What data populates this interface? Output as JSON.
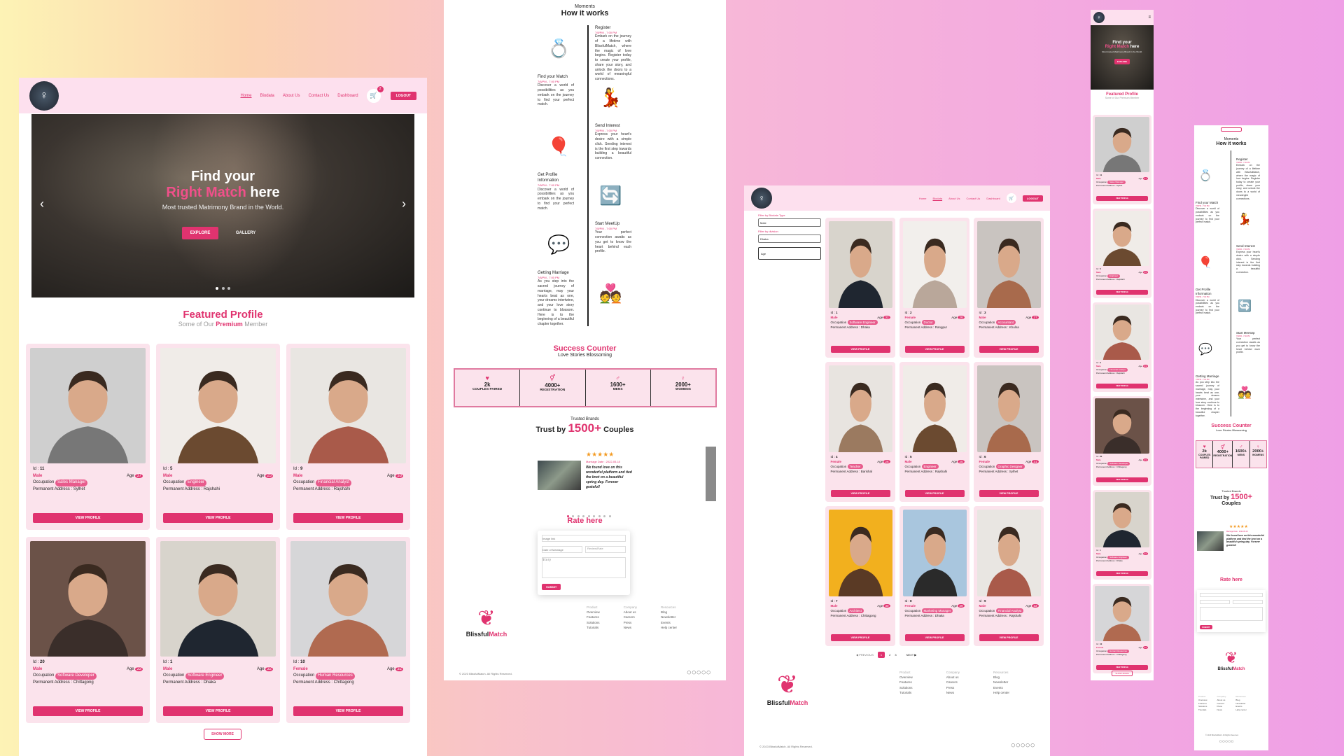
{
  "brand": {
    "name_a": "Blissful",
    "name_b": "Match",
    "copyright": "© 2023 BlissfulMatch. All Rights Reserved."
  },
  "nav": {
    "home": "Home",
    "biodata": "Biodata",
    "about": "About Us",
    "contact": "Contact Us",
    "dashboard": "Dashboard",
    "cart_count": "2",
    "logout": "LOGOUT"
  },
  "hero": {
    "line1": "Find your",
    "line2_accent": "Right Match",
    "line2_rest": " here",
    "subtitle": "Most trusted Matrimony Brand in the World.",
    "explore": "EXPLORE",
    "gallery": "GALLERY",
    "prev": "‹",
    "next": "›"
  },
  "featured": {
    "title": "Featured Profile",
    "sub_a": "Some of Our ",
    "sub_accent": "Premium",
    "sub_b": " Member",
    "show_more": "SHOW MORE",
    "view": "VIEW PROFILE",
    "addr_label": "Permanent Address : ",
    "occ_label": "Occupation ",
    "id_label": "Id : ",
    "age_label": "Age "
  },
  "profiles": [
    {
      "id": "11",
      "gender": "Male",
      "age": "37",
      "occupation": "Sales Manager",
      "address": "Sylhet",
      "tone": "#cfcfcf",
      "tone2": "#777"
    },
    {
      "id": "5",
      "gender": "Male",
      "age": "25",
      "occupation": "Engineer",
      "address": "Rajshahi",
      "tone": "#f0ece8",
      "tone2": "#6b4a30"
    },
    {
      "id": "9",
      "gender": "Male",
      "age": "33",
      "occupation": "Financial Analyst",
      "address": "Rajshahi",
      "tone": "#e9e6e2",
      "tone2": "#a95a4a"
    },
    {
      "id": "20",
      "gender": "Male",
      "age": "33",
      "occupation": "Software Developer",
      "address": "Chittagong",
      "tone": "#6b5248",
      "tone2": "#3a2e2a"
    },
    {
      "id": "1",
      "gender": "Male",
      "age": "32",
      "occupation": "Software Engineer",
      "address": "Dhaka",
      "tone": "#d8d4cc",
      "tone2": "#1f2630"
    },
    {
      "id": "10",
      "gender": "Female",
      "age": "32",
      "occupation": "Human Resources",
      "address": "Chittagong",
      "tone": "#d6d6d8",
      "tone2": "#b06a50"
    }
  ],
  "how": {
    "kicker": "Moments",
    "title": "How it works",
    "steps": [
      {
        "title": "Register",
        "time": "7/8/PM - 7:00 PM",
        "text": "Embark on the journey of a lifetime with BlissfulMatch, where the magic of love begins. Register today to create your profile, share your story, and unlock the doors to a world of meaningful connections.",
        "icon": "💍"
      },
      {
        "title": "Find your Match",
        "time": "7/8/PM - 7:00 PM",
        "text": "Discover a world of possibilities as you embark on the journey to find your perfect match.",
        "icon": "💃"
      },
      {
        "title": "Send Interest",
        "time": "7/8/PM - 7:00 PM",
        "text": "Express your heart's desire with a simple click. Sending interest is the first step towards building a beautiful connection.",
        "icon": "🎈"
      },
      {
        "title": "Get Profile Information",
        "time": "7/8/PM - 7:00 PM",
        "text": "Discover a world of possibilities as you embark on the journey to find your perfect match.",
        "icon": "🔄"
      },
      {
        "title": "Start MeetUp",
        "time": "7/8/PM - 7:00 PM",
        "text": "Your perfect connection awaits as you get to know the heart behind each profile.",
        "icon": "💬"
      },
      {
        "title": "Getting Marriage",
        "time": "7/8/PM - 7:00 PM",
        "text": "As you step into the sacred journey of marriage, may your hearts beat as one, your dreams intertwine, and your love story continue to blossom. Here is to the beginning of a beautiful chapter together.",
        "icon": "💑"
      }
    ]
  },
  "success": {
    "title": "Success Counter",
    "sub": "Love Stories Blossoming",
    "stats": [
      {
        "num": "2k",
        "label": "COUPLES PAIRED",
        "icon": "♥"
      },
      {
        "num": "4000+",
        "label": "REGISTRATION",
        "icon": "⚥"
      },
      {
        "num": "1600+",
        "label": "MENS",
        "icon": "♂"
      },
      {
        "num": "2000+",
        "label": "WOMENS",
        "icon": "♀"
      }
    ]
  },
  "trust": {
    "kicker": "Trusted Brands",
    "a": "Trust by ",
    "accent": "1500+",
    "b": " Couples",
    "stars": "★★★★★",
    "date": "Marriage Date : 2022-05-10",
    "quote": "We found love on this wonderful platform and tied the knot on a beautiful spring day. Forever grateful!"
  },
  "rate": {
    "title": "Rate here",
    "ph_name": "Image link",
    "ph_date": "Date of Marriage",
    "ph_select": "Review/Rate",
    "ph_story": "Story",
    "submit": "SUBMIT"
  },
  "footer": {
    "col1_title": "Product",
    "col1": [
      "Overview",
      "Features",
      "Solutions",
      "Tutorials"
    ],
    "col2_title": "Company",
    "col2": [
      "About us",
      "Careers",
      "Press",
      "News"
    ],
    "col3_title": "Resources",
    "col3": [
      "Blog",
      "Newsletter",
      "Events",
      "Help center"
    ],
    "socials": "◯ ◯ ◯ ◯ ◯"
  },
  "biodata": {
    "filter_type": "Filter by Biodata Type",
    "filter_div": "Filter by division",
    "type_val": "Male",
    "div_val": "Dhaka",
    "age_ph": "Age",
    "prev": "◀ PREVIOUS",
    "next": "NEXT ▶",
    "pages": [
      "1",
      "2",
      "3"
    ],
    "items": [
      {
        "id": "1",
        "gender": "Male",
        "age": "32",
        "occupation": "Software Engineer",
        "address": "Dhaka",
        "tone": "#d8d4cc",
        "tone2": "#1f2630"
      },
      {
        "id": "2",
        "gender": "Female",
        "age": "28",
        "occupation": "Doctor",
        "address": "Rangpur",
        "tone": "#f2efec",
        "tone2": "#b9a79a"
      },
      {
        "id": "3",
        "gender": "Male",
        "age": "27",
        "occupation": "Accountant",
        "address": "Khulna",
        "tone": "#c9c4c0",
        "tone2": "#a86a4c"
      },
      {
        "id": "4",
        "gender": "Female",
        "age": "26",
        "occupation": "Teacher",
        "address": "Barishal",
        "tone": "#e8e4e0",
        "tone2": "#9b7a60"
      },
      {
        "id": "5",
        "gender": "Male",
        "age": "25",
        "occupation": "Engineer",
        "address": "Rajshahi",
        "tone": "#f0ece8",
        "tone2": "#6b4a30"
      },
      {
        "id": "6",
        "gender": "Female",
        "age": "31",
        "occupation": "Graphic Designer",
        "address": "Sylhet",
        "tone": "#c9c4c0",
        "tone2": "#a86a4c"
      },
      {
        "id": "7",
        "gender": "Male",
        "age": "30",
        "occupation": "Architect",
        "address": "Chittagong",
        "tone": "#f2b01e",
        "tone2": "#5a3a25"
      },
      {
        "id": "8",
        "gender": "Female",
        "age": "29",
        "occupation": "Marketing Manager",
        "address": "Dhaka",
        "tone": "#a9c6de",
        "tone2": "#2a2a2a"
      },
      {
        "id": "9",
        "gender": "Male",
        "age": "33",
        "occupation": "Financial Analyst",
        "address": "Rajshahi",
        "tone": "#e9e6e2",
        "tone2": "#a95a4a"
      }
    ]
  },
  "mobile_fp": {
    "title": "Featured Profile",
    "sub": "Some of Our Premium Member"
  }
}
